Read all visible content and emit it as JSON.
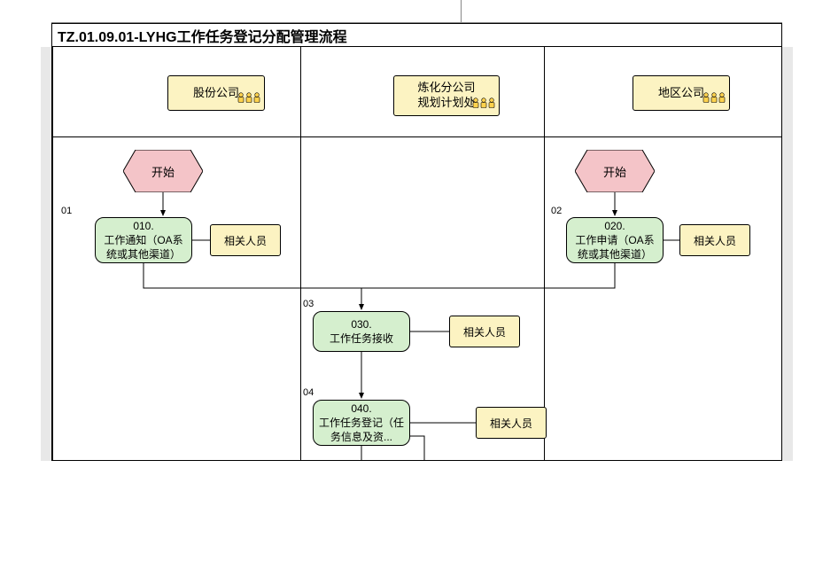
{
  "title": "TZ.01.09.01-LYHG工作任务登记分配管理流程",
  "lanes": {
    "lane1": "股份公司",
    "lane2": "炼化分公司\n规划计划处",
    "lane3": "地区公司"
  },
  "start": {
    "left": "开始",
    "right": "开始"
  },
  "steps": {
    "s01_num": "01",
    "s02_num": "02",
    "s03_num": "03",
    "s04_num": "04",
    "p010": "010.\n工作通知（OA系统或其他渠道）",
    "p020": "020.\n工作申请（OA系统或其他渠道）",
    "p030": "030.\n工作任务接收",
    "p040": "040.\n工作任务登记（任务信息及资...",
    "actor": "相关人员"
  }
}
